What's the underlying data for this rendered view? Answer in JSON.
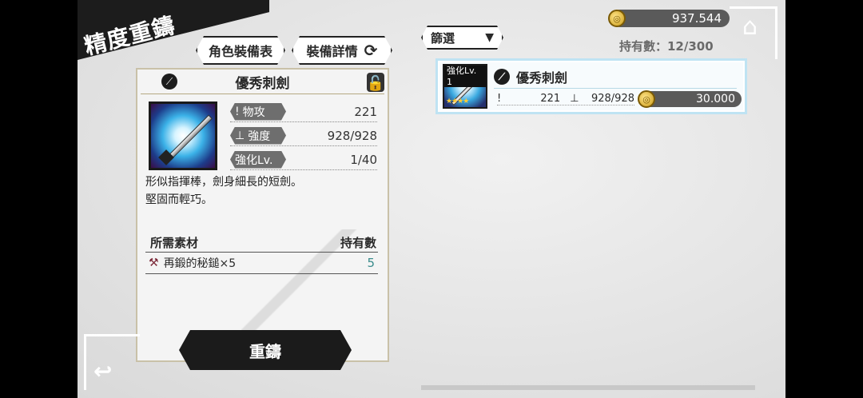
{
  "header": {
    "title": "精度重鑄"
  },
  "tabs": [
    {
      "label": "角色裝備表"
    },
    {
      "label": "裝備詳情"
    }
  ],
  "detail": {
    "item_name": "優秀刺劍",
    "stats": [
      {
        "label": "物攻",
        "value": "221"
      },
      {
        "label": "強度",
        "value": "928/928"
      },
      {
        "label": "強化Lv.",
        "value": "1/40"
      }
    ],
    "description": [
      "形似指揮棒，劍身細長的短劍。",
      "堅固而輕巧。"
    ],
    "materials_header": "所需素材",
    "owned_header": "持有數",
    "material": {
      "name": "再鍛的秘鎚×5",
      "owned": "5"
    },
    "action_label": "重鑄"
  },
  "filter": {
    "label": "篩選"
  },
  "currency": {
    "amount": "937.544"
  },
  "capacity": "持有數：12/300",
  "list": [
    {
      "level_tag": "強化Lv. 1",
      "stars": "★★★★",
      "name": "優秀刺劍",
      "attack": "221",
      "durability": "928/928",
      "price": "30.000"
    }
  ],
  "colors": {
    "banner": "#1c1c1c",
    "teal_count": "#3a8c8c",
    "card_border": "#bfe3f3"
  }
}
